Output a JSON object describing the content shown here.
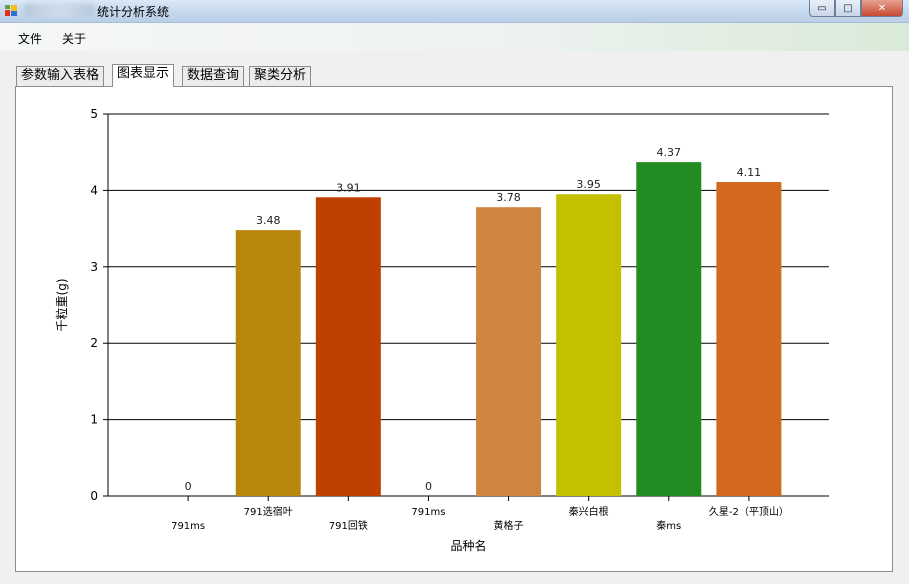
{
  "window": {
    "title": "统计分析系统",
    "buttons": {
      "minimize": "▭",
      "maximize": "□",
      "close": "✕"
    }
  },
  "menu": {
    "file": "文件",
    "about": "关于"
  },
  "tabs": [
    "参数输入表格",
    "图表显示",
    "数据查询",
    "聚类分析"
  ],
  "active_tab": 1,
  "chart_data": {
    "type": "bar",
    "categories": [
      "791ms",
      "791选宿叶",
      "791回铁",
      "791ms",
      "黄格子",
      "秦兴白根",
      "秦ms",
      "久星-2（平顶山）"
    ],
    "values": [
      0,
      3.48,
      3.91,
      0,
      3.78,
      3.95,
      4.37,
      4.11
    ],
    "value_labels": [
      "0",
      "3.48",
      "3.91",
      "0",
      "3.78",
      "3.95",
      "4.37",
      "4.11"
    ],
    "colors": [
      "#b8860b",
      "#b8860b",
      "#c04000",
      "#b8860b",
      "#cd853f",
      "#c4c000",
      "#228b22",
      "#d2691e"
    ],
    "xlabel": "品种名",
    "ylabel": "千粒重(g)",
    "ylim": [
      0,
      5
    ],
    "yticks": [
      "0",
      "1",
      "2",
      "3",
      "4",
      "5"
    ],
    "grid": true
  }
}
